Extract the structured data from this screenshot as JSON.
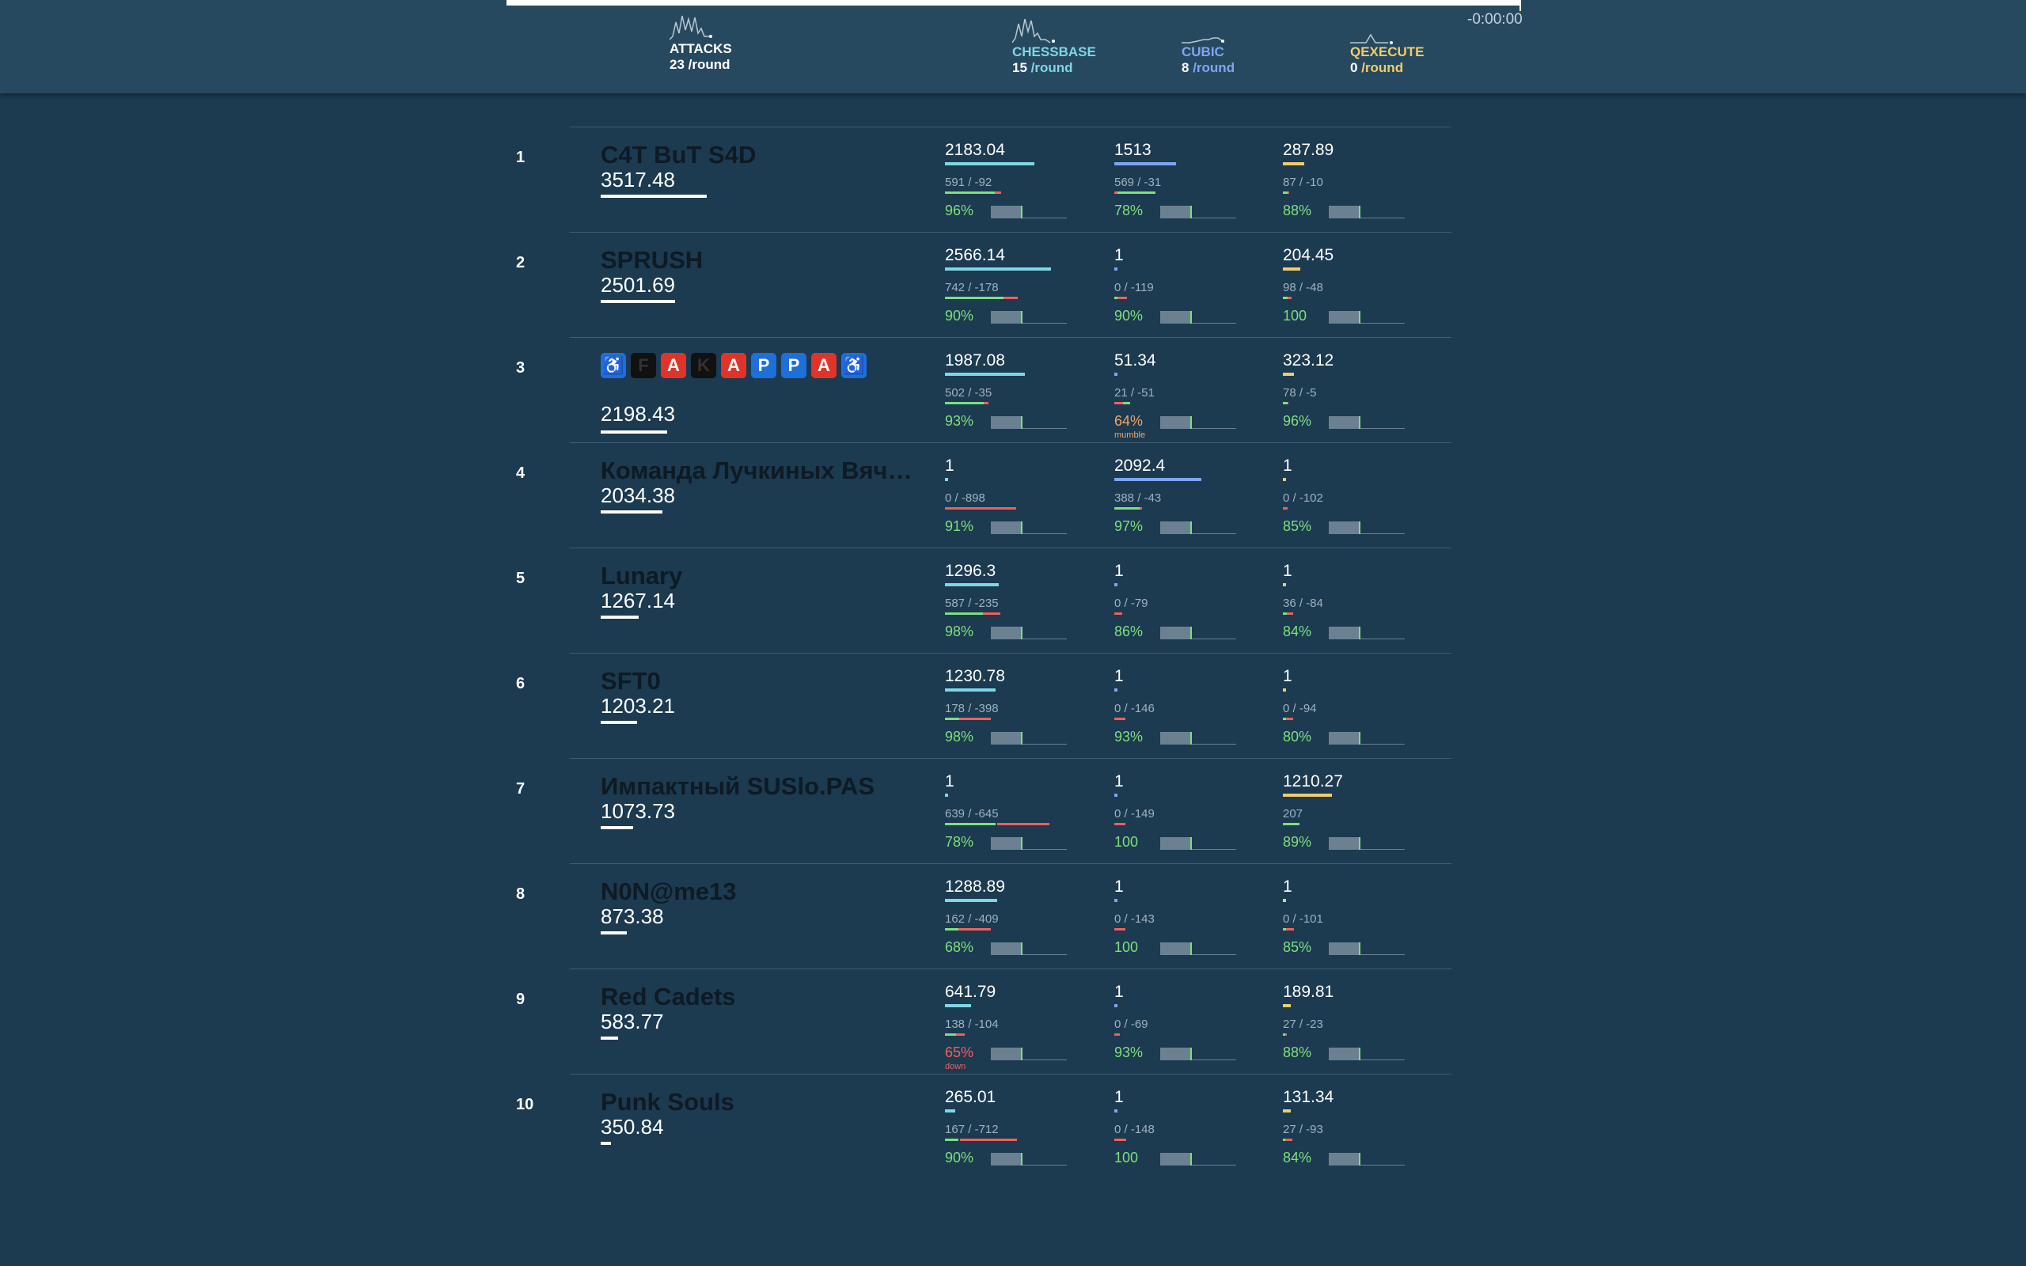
{
  "header": {
    "timer": "-0:00:00",
    "attacks": {
      "label": "ATTACKS",
      "value": "23",
      "unit": "/round"
    },
    "services": [
      {
        "name": "CHESSBASE",
        "value": "15",
        "unit": "/round",
        "color": "#7ed7e6"
      },
      {
        "name": "CUBIC",
        "value": "8",
        "unit": "/round",
        "color": "#7ea6f2"
      },
      {
        "name": "QEXECUTE",
        "value": "0",
        "unit": "/round",
        "color": "#f2cc6b"
      }
    ]
  },
  "colors": {
    "chessbase": "#7ed7e6",
    "cubic": "#7ea6f2",
    "qexecute": "#f2cc6b",
    "green": "#7ee07c",
    "red": "#f25f5c",
    "orange": "#f5a45d"
  },
  "teams": [
    {
      "rank": "1",
      "name": "C4T BuT S4D",
      "score": "3517.48",
      "services": [
        {
          "points": "2183.04",
          "fb": "591 / -92",
          "sla": "96%"
        },
        {
          "points": "1513",
          "fb": "569 / -31",
          "sla": "78%"
        },
        {
          "points": "287.89",
          "fb": "87 / -10",
          "sla": "88%"
        }
      ]
    },
    {
      "rank": "2",
      "name": "SPRUSH",
      "score": "2501.69",
      "services": [
        {
          "points": "2566.14",
          "fb": "742 / -178",
          "sla": "90%"
        },
        {
          "points": "1",
          "fb": "0 / -119",
          "sla": "90%"
        },
        {
          "points": "204.45",
          "fb": "98 / -48",
          "sla": "100"
        }
      ]
    },
    {
      "rank": "3",
      "name": "",
      "score": "2198.43",
      "emoji_name": [
        "♿",
        "F",
        "A",
        "K",
        "A",
        "P",
        "P",
        "A",
        "♿"
      ],
      "services": [
        {
          "points": "1987.08",
          "fb": "502 / -35",
          "sla": "93%"
        },
        {
          "points": "51.34",
          "fb": "21 / -51",
          "sla": "64%",
          "status": "mumble"
        },
        {
          "points": "323.12",
          "fb": "78 / -5",
          "sla": "96%"
        }
      ]
    },
    {
      "rank": "4",
      "name": "Команда Лучкиных Вячеслава",
      "score": "2034.38",
      "services": [
        {
          "points": "1",
          "fb": "0 / -898",
          "sla": "91%"
        },
        {
          "points": "2092.4",
          "fb": "388 / -43",
          "sla": "97%"
        },
        {
          "points": "1",
          "fb": "0 / -102",
          "sla": "85%"
        }
      ]
    },
    {
      "rank": "5",
      "name": "Lunary",
      "score": "1267.14",
      "services": [
        {
          "points": "1296.3",
          "fb": "587 / -235",
          "sla": "98%"
        },
        {
          "points": "1",
          "fb": "0 / -79",
          "sla": "86%"
        },
        {
          "points": "1",
          "fb": "36 / -84",
          "sla": "84%"
        }
      ]
    },
    {
      "rank": "6",
      "name": "SFT0",
      "score": "1203.21",
      "services": [
        {
          "points": "1230.78",
          "fb": "178 / -398",
          "sla": "98%"
        },
        {
          "points": "1",
          "fb": "0 / -146",
          "sla": "93%"
        },
        {
          "points": "1",
          "fb": "0 / -94",
          "sla": "80%"
        }
      ]
    },
    {
      "rank": "7",
      "name": "Импактный SUSlo.PAS",
      "score": "1073.73",
      "services": [
        {
          "points": "1",
          "fb": "639 / -645",
          "sla": "78%"
        },
        {
          "points": "1",
          "fb": "0 / -149",
          "sla": "100"
        },
        {
          "points": "1210.27",
          "fb": "207",
          "sla": "89%"
        }
      ]
    },
    {
      "rank": "8",
      "name": "N0N@me13",
      "score": "873.38",
      "services": [
        {
          "points": "1288.89",
          "fb": "162 / -409",
          "sla": "68%"
        },
        {
          "points": "1",
          "fb": "0 / -143",
          "sla": "100"
        },
        {
          "points": "1",
          "fb": "0 / -101",
          "sla": "85%"
        }
      ]
    },
    {
      "rank": "9",
      "name": "Red Cadets",
      "score": "583.77",
      "services": [
        {
          "points": "641.79",
          "fb": "138 / -104",
          "sla": "65%",
          "status": "down"
        },
        {
          "points": "1",
          "fb": "0 / -69",
          "sla": "93%"
        },
        {
          "points": "189.81",
          "fb": "27 / -23",
          "sla": "88%"
        }
      ]
    },
    {
      "rank": "10",
      "name": "Punk Souls",
      "score": "350.84",
      "services": [
        {
          "points": "265.01",
          "fb": "167 / -712",
          "sla": "90%"
        },
        {
          "points": "1",
          "fb": "0 / -148",
          "sla": "100"
        },
        {
          "points": "131.34",
          "fb": "27 / -93",
          "sla": "84%"
        }
      ]
    }
  ]
}
